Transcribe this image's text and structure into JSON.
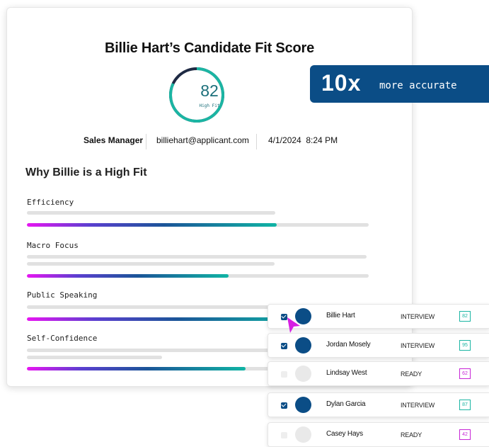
{
  "card": {
    "title": "Billie Hart’s Candidate Fit Score",
    "score": "82",
    "score_label": "High Fit",
    "score_fraction": 0.82,
    "role": "Sales Manager",
    "email": "billiehart@applicant.com",
    "datetime": "4/1/2024  8:24 PM",
    "section_title": "Why Billie is a High Fit",
    "criteria": [
      {
        "label": "Efficiency",
        "level": 0.73
      },
      {
        "label": "Macro Focus",
        "level": 0.59
      },
      {
        "label": "Public Speaking",
        "level": 0.8
      },
      {
        "label": "Self-Confidence",
        "level": 0.64
      }
    ]
  },
  "badge": {
    "big": "10x",
    "small": "more accurate"
  },
  "candidates": [
    {
      "name": "Billie Hart",
      "status": "INTERVIEW",
      "score": "82",
      "checked": true
    },
    {
      "name": "Jordan Mosely",
      "status": "INTERVIEW",
      "score": "95",
      "checked": true
    },
    {
      "name": "Lindsay West",
      "status": "READY",
      "score": "62",
      "checked": false
    },
    {
      "name": "Dylan Garcia",
      "status": "INTERVIEW",
      "score": "87",
      "checked": true
    },
    {
      "name": "Casey Hays",
      "status": "READY",
      "score": "42",
      "checked": false
    }
  ],
  "colors": {
    "brand_blue": "#0b4d86",
    "teal": "#1bb5a3",
    "magenta": "#c726d6",
    "gauge_track": "#1f2a44"
  }
}
